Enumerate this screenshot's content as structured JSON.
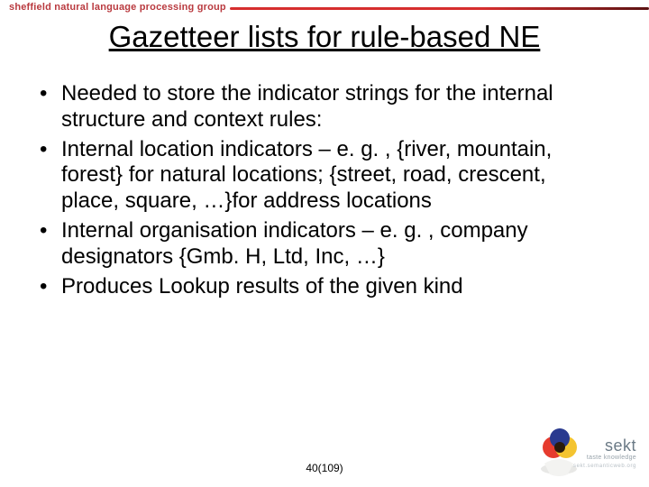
{
  "header": {
    "group": "sheffield natural language processing group"
  },
  "title": "Gazetteer lists for rule-based NE",
  "bullets": [
    "Needed to store the indicator strings for the internal structure and context rules:",
    "Internal location indicators – e. g. , {river, mountain, forest} for natural locations; {street, road, crescent, place, square, …}for address locations",
    "Internal organisation indicators – e. g. , company designators {Gmb. H, Ltd, Inc, …}",
    "Produces Lookup results of the given kind"
  ],
  "footer": {
    "page": "40(109)"
  },
  "logo": {
    "name": "sekt",
    "tagline": "taste knowledge",
    "url": "sekt.semanticweb.org"
  }
}
